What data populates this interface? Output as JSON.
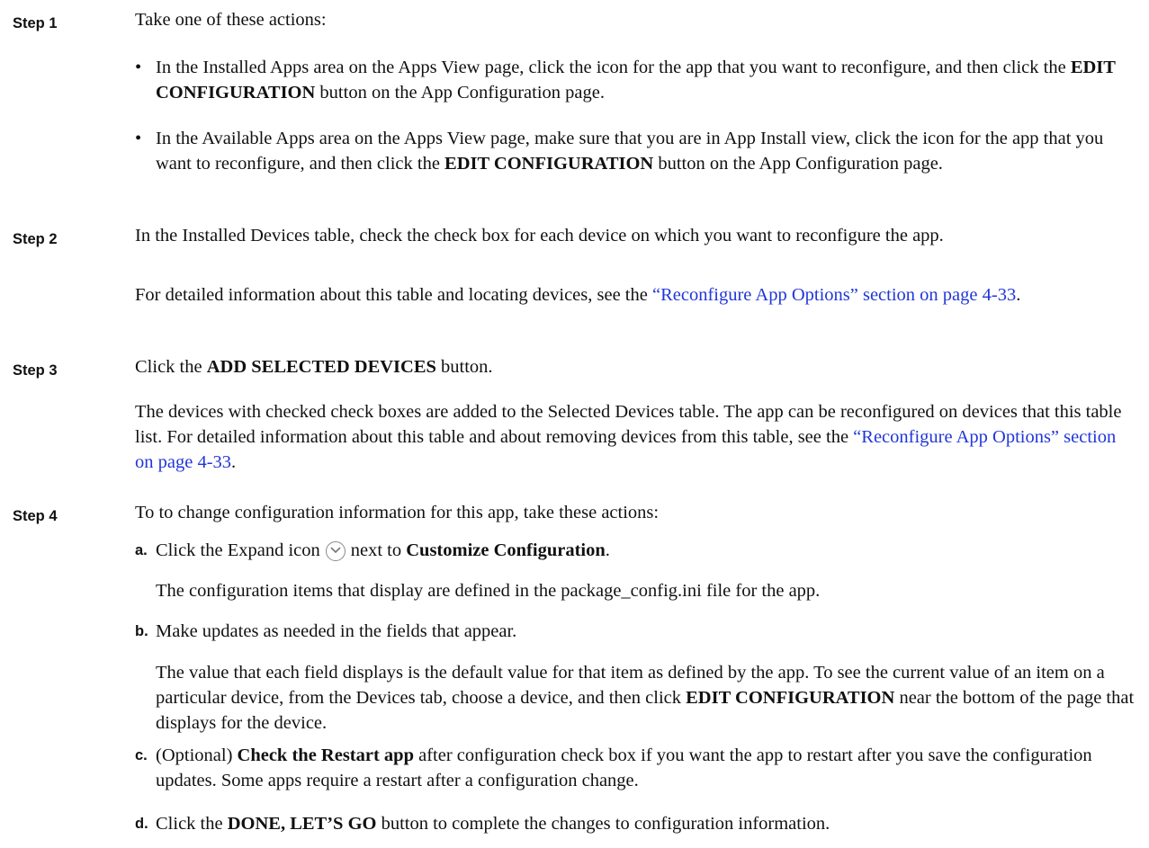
{
  "steps": [
    {
      "label": "Step 1",
      "intro": "Take one of these actions:",
      "bullets": [
        {
          "text1": "In the Installed Apps area on the Apps View page, click the icon for the app that you want to reconfigure, and then click the ",
          "bold1": "EDIT CONFIGURATION",
          "text2": " button on the App Configuration page."
        },
        {
          "text1": "In the Available Apps area on the Apps View page, make sure that you are in App Install view, click the icon for the app that you want to reconfigure, and then click the ",
          "bold1": "EDIT CONFIGURATION",
          "text2": " button on the App Configuration page."
        }
      ]
    },
    {
      "label": "Step 2",
      "text": "In the Installed Devices table, check the check box for each device on which you want to reconfigure the app.",
      "note_pre": "For detailed information about this table and locating devices, see the ",
      "note_link": "“Reconfigure App Options” section on page 4-33",
      "note_post": "."
    },
    {
      "label": "Step 3",
      "text_pre": "Click the ",
      "text_bold": "ADD SELECTED DEVICES",
      "text_post": " button.",
      "note_pre": "The devices with checked check boxes are added to the Selected Devices table. The app can be reconfigured on devices that this table list. For detailed information about this table and about removing devices from this table, see the ",
      "note_link": "“Reconfigure App Options” section on page 4-33",
      "note_post": "."
    },
    {
      "label": "Step 4",
      "intro": "To to change configuration information for this app, take these actions:",
      "substeps": [
        {
          "letter": "a.",
          "text_pre": "Click the Expand icon",
          "icon": "expand-icon",
          "text_mid": "next to ",
          "text_bold": "Customize Configuration",
          "text_post": ".",
          "note": "The configuration items that display are defined in the package_config.ini file for the app."
        },
        {
          "letter": "b.",
          "text": "Make updates as needed in the fields that appear.",
          "note_pre": "The value that each field displays is the default value for that item as defined by the app. To see the current value of an item on a particular device, from the Devices tab, choose a device, and then click ",
          "note_bold": "EDIT CONFIGURATION",
          "note_post": " near the bottom of the page that displays for the device."
        },
        {
          "letter": "c.",
          "text_pre": "(Optional) ",
          "text_bold": "Check the Restart app",
          "text_post": " after configuration check box if you want the app to restart after you save the configuration updates. Some apps require a restart after a configuration change."
        },
        {
          "letter": "d.",
          "text_pre": "Click the ",
          "text_bold": "DONE, LET’S GO",
          "text_post": " button to complete the changes to configuration information."
        }
      ]
    }
  ]
}
